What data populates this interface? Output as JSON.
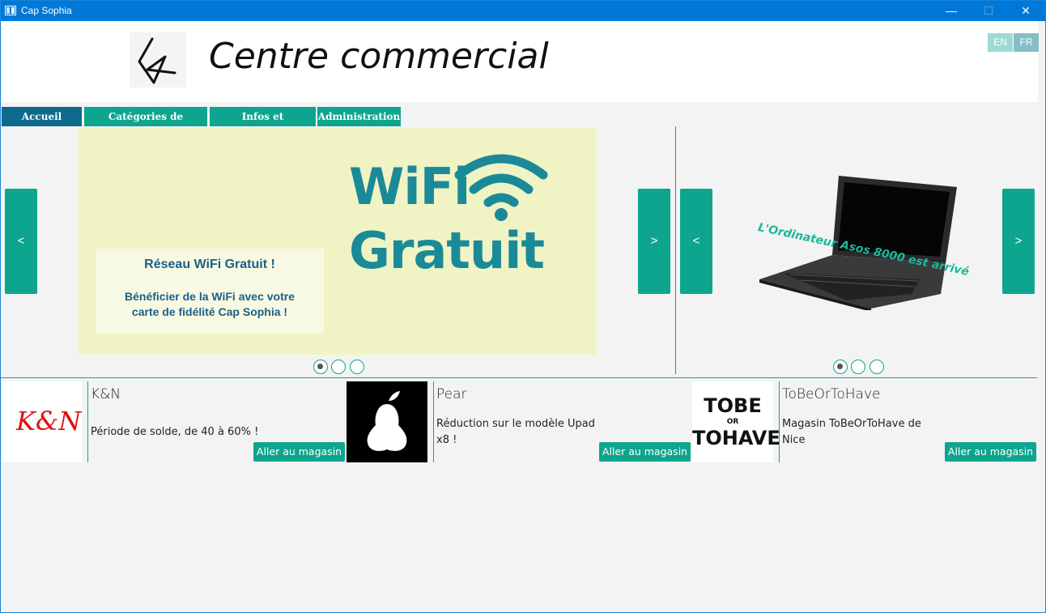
{
  "window": {
    "title": "Cap Sophia",
    "controls": [
      "—",
      "☐",
      "✕"
    ]
  },
  "header": {
    "app_title": "Centre commercial",
    "lang_en": "EN",
    "lang_fr": "FR"
  },
  "tabs": [
    {
      "label": "Accueil"
    },
    {
      "label": "Catégories de magasin"
    },
    {
      "label": "Infos et localisation"
    },
    {
      "label": "Administration"
    }
  ],
  "carousel_left": {
    "prev": "<",
    "next": ">",
    "wifi_line1": "WiFi",
    "wifi_line2": "Gratuit",
    "card_title": "Réseau WiFi Gratuit !",
    "card_line1": "Bénéficier de la WiFi avec votre",
    "card_line2": "carte de fidélité Cap Sophia !",
    "slides": 3,
    "active_slide": 1
  },
  "carousel_right": {
    "prev": "<",
    "next": ">",
    "caption": "L'Ordinateur Asos 8000 est arrivé",
    "slides": 3,
    "active_slide": 1
  },
  "stores": [
    {
      "name": "K&N",
      "logo_text": "K&N",
      "desc_line1": "Période de solde, de 40 à 60% !",
      "desc_line2": "",
      "button": "Aller au magasin"
    },
    {
      "name": "Pear",
      "desc_line1": "Réduction sur le modèle Upad",
      "desc_line2": "x8 !",
      "button": "Aller au magasin"
    },
    {
      "name": "ToBeOrToHave",
      "logo_line1": "TOBE",
      "logo_line2": "OR",
      "logo_line3": "TOHAVE",
      "desc_line1": "Magasin ToBeOrToHave de",
      "desc_line2": "Nice",
      "button": "Aller au magasin"
    }
  ],
  "colors": {
    "accent": "#0ea58f",
    "active_tab": "#0d6a8c",
    "titlebar": "#0078d7",
    "wifi_bg": "#f0f3c4",
    "wifi_text": "#1b8a98"
  }
}
